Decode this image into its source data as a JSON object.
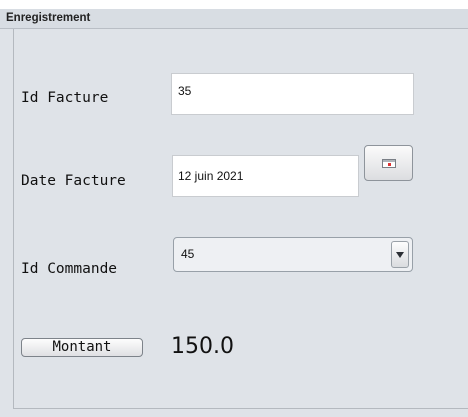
{
  "panel": {
    "title": "Enregistrement"
  },
  "form": {
    "id_facture": {
      "label": "Id Facture",
      "value": "35"
    },
    "date_facture": {
      "label": "Date Facture",
      "value": "12 juin 2021",
      "picker_icon": "calendar-icon"
    },
    "id_commande": {
      "label": "Id Commande",
      "selected": "45",
      "arrow_icon": "chevron-down-icon"
    },
    "montant": {
      "button_label": "Montant",
      "value": "150.0"
    }
  }
}
